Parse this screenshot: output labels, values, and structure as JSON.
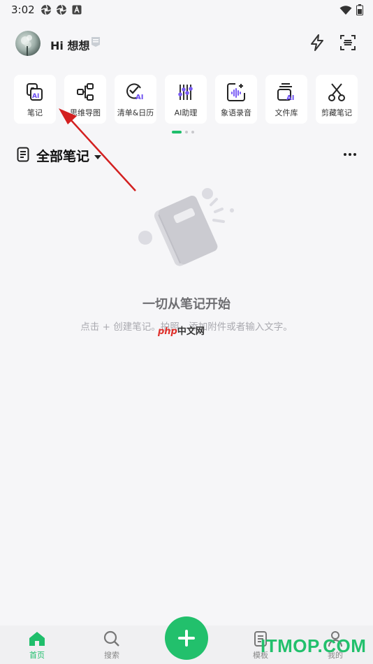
{
  "status_bar": {
    "time": "3:02"
  },
  "header": {
    "greeting": "Hi 想想"
  },
  "tools": [
    {
      "label": "笔记",
      "icon": "ai-note-icon"
    },
    {
      "label": "思维导图",
      "icon": "mind-map-icon"
    },
    {
      "label": "清单&日历",
      "icon": "checklist-ai-icon"
    },
    {
      "label": "AI助理",
      "icon": "ai-assistant-icon"
    },
    {
      "label": "象语录音",
      "icon": "voice-record-icon"
    },
    {
      "label": "文件库",
      "icon": "file-library-icon"
    },
    {
      "label": "剪藏笔记",
      "icon": "clip-note-icon"
    }
  ],
  "section": {
    "title": "全部笔记"
  },
  "empty_state": {
    "title": "一切从笔记开始",
    "subtitle": "点击 + 创建笔记。拍照、添加附件或者输入文字。"
  },
  "watermark": {
    "php": "php",
    "cn": "中文网",
    "site": "ITMOP.COM"
  },
  "bottom_nav": [
    {
      "label": "首页",
      "active": true
    },
    {
      "label": "搜索",
      "active": false
    },
    {
      "label": "模板",
      "active": false
    },
    {
      "label": "我的",
      "active": false
    }
  ],
  "colors": {
    "accent": "#22c06c",
    "arrow": "#d32020",
    "background": "#f6f6f8"
  }
}
